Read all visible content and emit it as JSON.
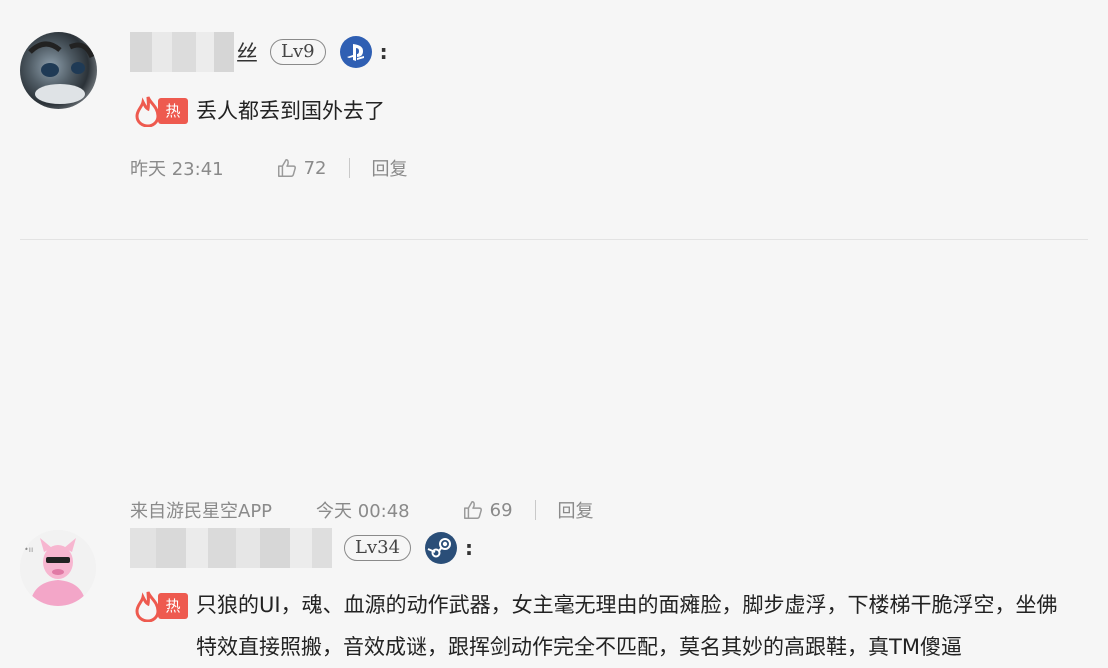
{
  "comments": [
    {
      "name_suffix": "丝",
      "level": "Lv9",
      "platform_icon": "playstation-icon",
      "menu": ":",
      "hot_badge": "热",
      "text": "丢人都丢到国外去了",
      "time": "昨天 23:41",
      "likes": "72",
      "reply": "回复"
    },
    {
      "level": "Lv34",
      "platform_icon": "steam-icon",
      "menu": ":",
      "hot_badge": "热",
      "text": "只狼的UI，魂、血源的动作武器，女主毫无理由的面瘫脸，脚步虚浮，下楼梯干脆浮空，坐佛特效直接照搬，音效成谜，跟挥剑动作完全不匹配，莫名其妙的高跟鞋，真TM傻逼",
      "source": "来自游民星空APP",
      "time": "今天 00:48",
      "likes": "69",
      "reply": "回复"
    }
  ],
  "colors": {
    "background": "#f6f6f6",
    "hot_red": "#ee5a4f",
    "meta_gray": "#8a8a8a",
    "playstation_blue": "#2f5fb3",
    "steam_blue": "#2a4e78"
  }
}
